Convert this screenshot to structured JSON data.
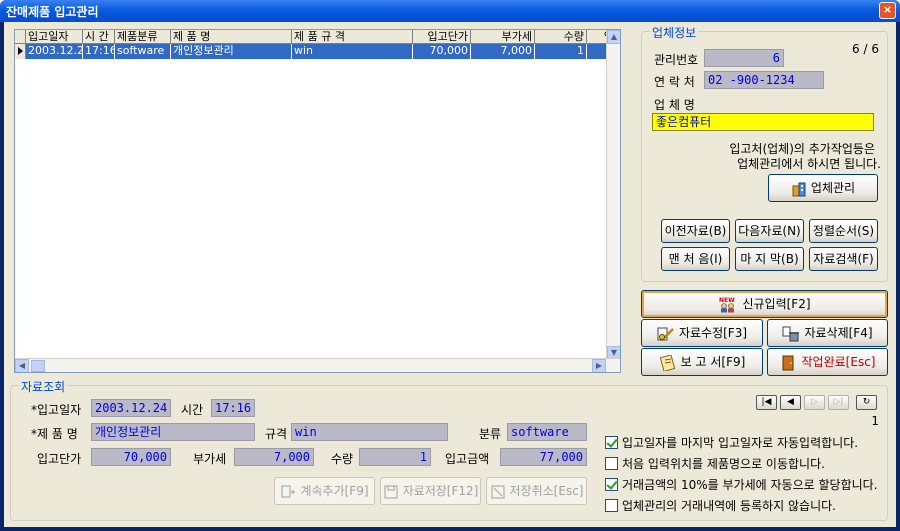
{
  "window": {
    "title": "잔매제품 입고관리",
    "close": "×"
  },
  "grid": {
    "columns": [
      "입고일자",
      "시 간",
      "제품분류",
      "제 품 명",
      "제 품 규 격",
      "입고단가",
      "부가세",
      "수량",
      "입고"
    ],
    "rows": [
      [
        "2003.12.24",
        "17:16",
        "software",
        "개인정보관리",
        "win",
        "70,000",
        "7,000",
        "1",
        "7"
      ]
    ]
  },
  "vendor": {
    "group_title": "업체정보",
    "record_counter": "6 / 6",
    "mgmt_no_label": "관리번호",
    "mgmt_no": "6",
    "contact_label": "연 락 처",
    "contact": "02 -900-1234",
    "name_label": "업 체 명",
    "name": "좋은컴퓨터",
    "note_line1": "입고처(업체)의 추가작업등은",
    "note_line2": "업체관리에서 하시면 됩니다.",
    "manage_button": "업체관리"
  },
  "nav_buttons": {
    "prev": "이전자료(B)",
    "next": "다음자료(N)",
    "sort": "정렬순서(S)",
    "first": "맨 처 음(I)",
    "last": "마 지 막(B)",
    "search": "자료검색(F)"
  },
  "actions": {
    "new_badge": "NEW",
    "new_entry": "신규입력[F2]",
    "edit": "자료수정[F3]",
    "delete": "자료삭제[F4]",
    "report": "보 고 서[F9]",
    "done": "작업완료[Esc]"
  },
  "lookup": {
    "group_title": "자료조회",
    "date_label": "*입고일자",
    "date": "2003.12.24",
    "time_label": "시간",
    "time": "17:16",
    "product_label": "*제 품 명",
    "product": "개인정보관리",
    "spec_label": "규격",
    "spec": "win",
    "category_label": "분류",
    "category": "software",
    "unit_price_label": "입고단가",
    "unit_price": "70,000",
    "vat_label": "부가세",
    "vat": "7,000",
    "qty_label": "수량",
    "qty": "1",
    "amount_label": "입고금액",
    "amount": "77,000",
    "page_indicator": "1",
    "continue_add": "계속추가[F9]",
    "save": "자료저장[F12]",
    "cancel": "저장취소[Esc]"
  },
  "options": [
    {
      "label": "입고일자를 마지막 입고일자로 자동입력합니다.",
      "checked": true
    },
    {
      "label": "처음 입력위치를 제품명으로 이동합니다.",
      "checked": false
    },
    {
      "label": "거래금액의 10%를 부가세에 자동으로 할당합니다.",
      "checked": true
    },
    {
      "label": "업체관리의 거래내역에 등록하지 않습니다.",
      "checked": false
    }
  ]
}
